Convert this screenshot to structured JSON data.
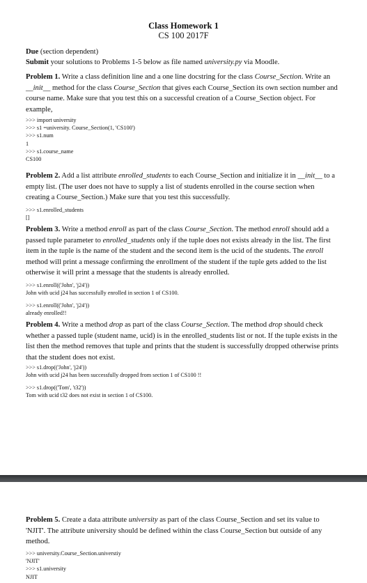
{
  "header": {
    "title": "Class Homework 1",
    "subtitle": "CS 100 2017F"
  },
  "due": {
    "label": "Due",
    "text": " (section dependent)"
  },
  "submit": {
    "label": "Submit",
    "text_before": " your solutions to Problems 1-5 below as file named ",
    "filename": "university.py",
    "text_after": " via Moodle."
  },
  "problems": [
    {
      "label": "Problem 1.",
      "segments": [
        {
          "t": " Write a class definition line and a one line docstring for the class "
        },
        {
          "t": "Course_Section",
          "i": true
        },
        {
          "t": ". Write an "
        },
        {
          "t": "__init__",
          "i": true
        },
        {
          "t": " method for the class "
        },
        {
          "t": "Course_Section",
          "i": true
        },
        {
          "t": " that gives each Course_Section its own section number and course name. Make sure that you test this on a successful creation of a Course_Section object. For example,"
        }
      ],
      "code": [
        ">>> import university\n>>> s1 =university. Course_Section(1, 'CS100')\n>>> s1.num\n1\n>>> s1.course_name\nCS100"
      ]
    },
    {
      "label": "Problem 2.",
      "segments": [
        {
          "t": " Add a list attribute "
        },
        {
          "t": "enrolled_students",
          "i": true
        },
        {
          "t": " to each Course_Section and initialize it in "
        },
        {
          "t": "__init__",
          "i": true
        },
        {
          "t": " to a empty list. (The user does not have to supply a list of students enrolled in the course section when creating a Course_Section.)  Make sure that you test this successfully."
        }
      ],
      "code": [
        ">>> s1.enrolled_students\n[]"
      ]
    },
    {
      "label": "Problem 3.",
      "segments": [
        {
          "t": " Write a method "
        },
        {
          "t": "enroll",
          "i": true
        },
        {
          "t": " as part of the class "
        },
        {
          "t": "Course_Section",
          "i": true
        },
        {
          "t": ". The method "
        },
        {
          "t": "enroll",
          "i": true
        },
        {
          "t": " should add a passed tuple parameter to "
        },
        {
          "t": "enrolled_students",
          "i": true
        },
        {
          "t": " only if the tuple does not exists already in the list. The first item in the tuple is the name of the student and the second item is the ucid of the students. The "
        },
        {
          "t": "enroll",
          "i": true
        },
        {
          "t": " method will print a message confirming the enrollment of the student if the tuple gets added to the list otherwise it will print a message that the students is already enrolled."
        }
      ],
      "code": [
        ">>> s1.enroll(('John', 'j24'))\nJohn with ucid j24 has successfully enrolled in section 1 of CS100.",
        ">>> s1.enroll(('John', 'j24'))\nalready enrolled!!"
      ]
    },
    {
      "label": "Problem 4.",
      "segments": [
        {
          "t": " Write a method "
        },
        {
          "t": "drop",
          "i": true
        },
        {
          "t": " as part of the class "
        },
        {
          "t": "Course_Section",
          "i": true
        },
        {
          "t": ". The method "
        },
        {
          "t": "drop",
          "i": true
        },
        {
          "t": " should check whether a passed tuple (student name, ucid) is in the enrolled_students list or not. If the tuple exists in the list then the method removes that tuple and prints that the student is successfully dropped otherwise prints that the student does not exist."
        }
      ],
      "code": [
        ">>> s1.drop(('John', 'j24'))\nJohn with ucid j24 has been successfully dropped from section 1 of CS100 !!",
        ">>> s1.drop(('Tom', 't32'))\nTom with ucid t32 does not exist in section 1 of CS100."
      ]
    },
    {
      "label": "Problem 5.",
      "segments": [
        {
          "t": " Create a data attribute "
        },
        {
          "t": "university",
          "i": true
        },
        {
          "t": " as part of the class Course_Section and set its value to 'NJIT'. The attribute university should be defined within the class Course_Section but outside of any method."
        }
      ],
      "code": [
        ">>> university.Course_Section.universtiy\n'NJIT'\n>>> s1.university\nNJIT"
      ]
    }
  ]
}
